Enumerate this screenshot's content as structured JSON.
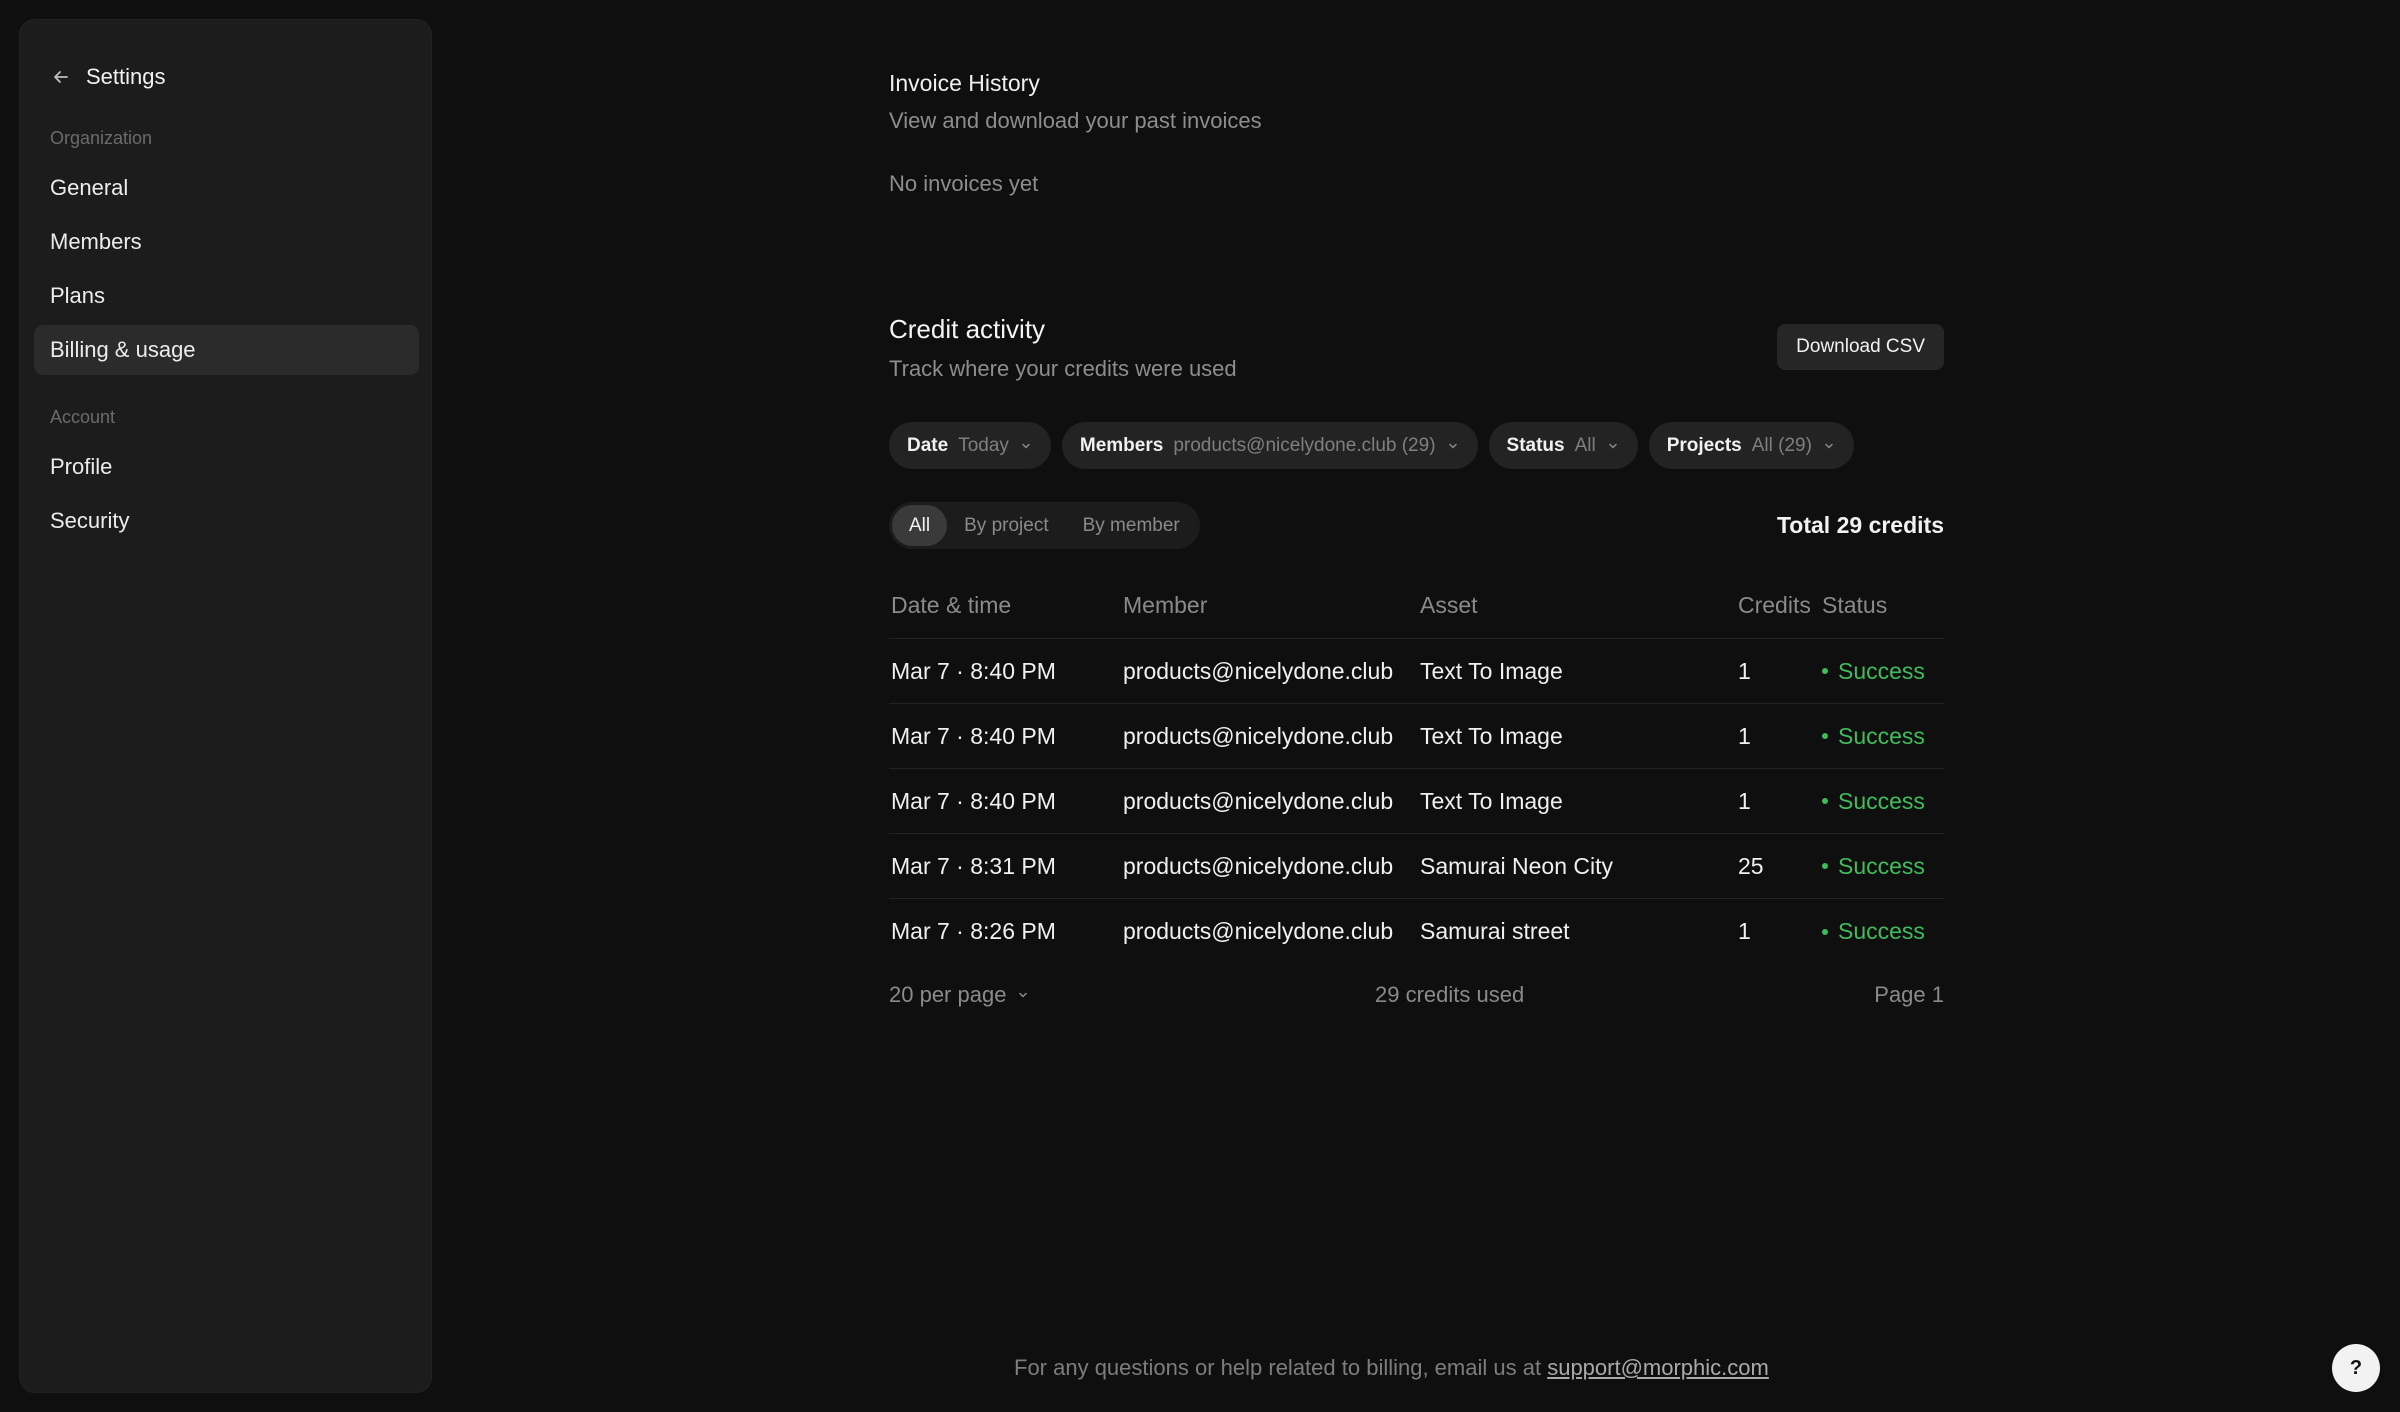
{
  "sidebar": {
    "title": "Settings",
    "sections": [
      {
        "label": "Organization",
        "items": [
          "General",
          "Members",
          "Plans",
          "Billing & usage"
        ]
      },
      {
        "label": "Account",
        "items": [
          "Profile",
          "Security"
        ]
      }
    ],
    "active_item": "Billing & usage"
  },
  "invoice": {
    "title": "Invoice History",
    "subtitle": "View and download your past invoices",
    "empty": "No invoices yet"
  },
  "credits": {
    "title": "Credit activity",
    "subtitle": "Track where your credits were used",
    "download_label": "Download CSV",
    "filters": [
      {
        "key": "Date",
        "value": "Today"
      },
      {
        "key": "Members",
        "value": "products@nicelydone.club (29)"
      },
      {
        "key": "Status",
        "value": "All"
      },
      {
        "key": "Projects",
        "value": "All (29)"
      }
    ],
    "segments": [
      "All",
      "By project",
      "By member"
    ],
    "active_segment": "All",
    "total": "Total 29 credits",
    "columns": [
      "Date & time",
      "Member",
      "Asset",
      "Credits",
      "Status"
    ],
    "rows": [
      [
        "Mar 7 · 8:40 PM",
        "products@nicelydone.club",
        "Text To Image",
        "1",
        "Success"
      ],
      [
        "Mar 7 · 8:40 PM",
        "products@nicelydone.club",
        "Text To Image",
        "1",
        "Success"
      ],
      [
        "Mar 7 · 8:40 PM",
        "products@nicelydone.club",
        "Text To Image",
        "1",
        "Success"
      ],
      [
        "Mar 7 · 8:31 PM",
        "products@nicelydone.club",
        "Samurai Neon City",
        "25",
        "Success"
      ],
      [
        "Mar 7 · 8:26 PM",
        "products@nicelydone.club",
        "Samurai street",
        "1",
        "Success"
      ]
    ],
    "per_page": "20 per page",
    "used": "29 credits used",
    "page": "Page 1"
  },
  "footer": {
    "note": "For any questions or help related to billing, email us at",
    "email": "support@morphic.com"
  },
  "help_label": "?",
  "colors": {
    "success": "#3fbd5c",
    "background": "#0f0f0f",
    "sidebar": "#1c1c1c"
  }
}
